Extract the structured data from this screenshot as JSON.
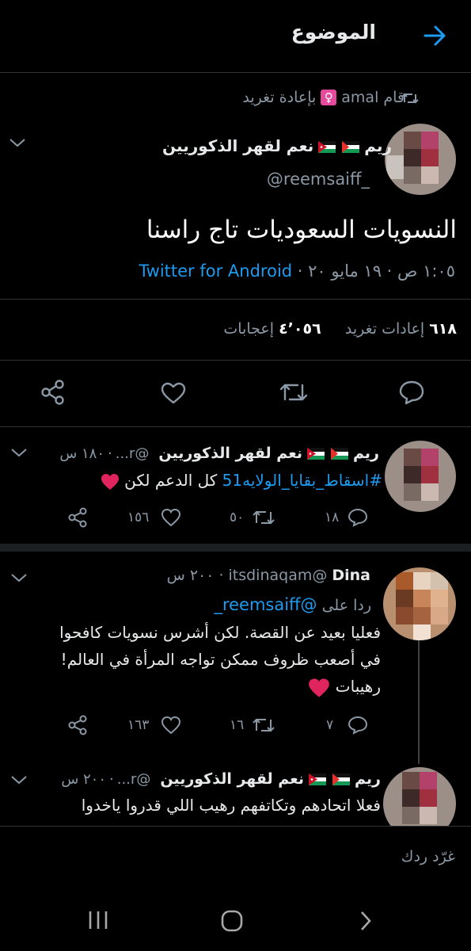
{
  "header": {
    "title": "الموضوع",
    "back_icon": "arrow-right-icon"
  },
  "retweet": {
    "text_prefix": "قام",
    "user": "amal",
    "emoji": "♀",
    "text_suffix": "بإعادة تغريد"
  },
  "main_tweet": {
    "name": "ريم",
    "name_suffix": "نعم لقهر الذكوريين",
    "handle": "@reemsaiff_",
    "text": "النسويات السعوديات تاج راسنا",
    "time": "١:٠٥ ص · ١٩ مايو ٢٠",
    "separator": " · ",
    "source": "Twitter for Android",
    "retweets_count": "٦١٨",
    "retweets_label": "إعادات تغريد",
    "likes_count": "٤٬٠٥٦",
    "likes_label": "إعجابات"
  },
  "reply1": {
    "name": "ريم",
    "name_suffix": "نعم لقهر الذكوريين",
    "handle": "@r...",
    "time": "١٨٠ س",
    "hashtag": "#اسقاط_بقايا_الولايه51",
    "text": "كل الدعم لكن",
    "reply_count": "١٨",
    "retweet_count": "٥٠",
    "like_count": "١٥٦"
  },
  "reply2": {
    "name": "Dina",
    "handle": "@itsdinaqam",
    "time": "٢٠٠ س",
    "reply_to_label": "ردا على",
    "reply_to_handle": "@reemsaiff_",
    "line1": "فعليا بعيد عن القصة. لكن أشرس نسويات كافحوا",
    "line2": "في أصعب ظروف  ممكن تواجه المرأة في العالم!",
    "line3": "رهيبات",
    "reply_count": "٧",
    "retweet_count": "١٦",
    "like_count": "١٦٣"
  },
  "reply3": {
    "name": "ريم",
    "name_suffix": "نعم لقهر الذكوريين",
    "handle": "@r...",
    "time": "٢٠٠ س",
    "line1": "فعلا اتحادهم وتكاتفهم رهيب اللي قدروا ياخدوا"
  },
  "compose": {
    "placeholder": "غرّد ردك"
  },
  "colors": {
    "accent": "#1d9bf0",
    "heart": "#e0245e",
    "background": "#000000"
  }
}
